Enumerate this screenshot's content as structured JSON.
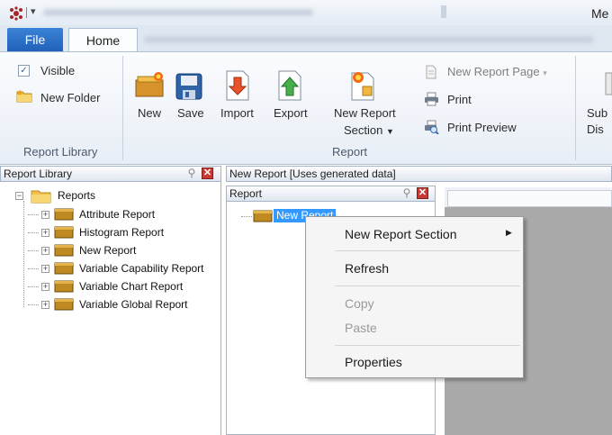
{
  "titlebar": {
    "title_partial": "Me"
  },
  "tabs": [
    {
      "label": "File"
    },
    {
      "label": "Home"
    }
  ],
  "ribbon": {
    "report_library": {
      "visible_label": "Visible",
      "visible_checked": true,
      "new_folder_label": "New Folder",
      "group_label": "Report Library"
    },
    "report": {
      "new_label": "New",
      "save_label": "Save",
      "import_label": "Import",
      "export_label": "Export",
      "new_report_section_line1": "New Report",
      "new_report_section_line2": "Section",
      "new_report_page_label": "New Report Page",
      "print_label": "Print",
      "print_preview_label": "Print Preview",
      "group_label": "Report"
    },
    "cut_off": {
      "line1": "Sub",
      "line2": "Dis"
    }
  },
  "report_library_panel": {
    "title": "Report Library",
    "root_label": "Reports",
    "items": [
      {
        "label": "Attribute Report"
      },
      {
        "label": "Histogram Report"
      },
      {
        "label": "New Report"
      },
      {
        "label": "Variable Capability Report"
      },
      {
        "label": "Variable Chart Report"
      },
      {
        "label": "Variable Global Report"
      }
    ]
  },
  "document": {
    "title": "New Report  [Uses generated data]",
    "report_panel_title": "Report",
    "tree_node": "New Report"
  },
  "context_menu": {
    "items": [
      {
        "label": "New Report Section",
        "submenu": true,
        "enabled": true
      },
      {
        "label": "Refresh",
        "enabled": true
      },
      {
        "label": "Copy",
        "enabled": false
      },
      {
        "label": "Paste",
        "enabled": false
      },
      {
        "label": "Properties",
        "enabled": true
      }
    ]
  },
  "colors": {
    "accent": "#1f5fb8",
    "selection": "#3399ff",
    "close": "#c93a32"
  }
}
